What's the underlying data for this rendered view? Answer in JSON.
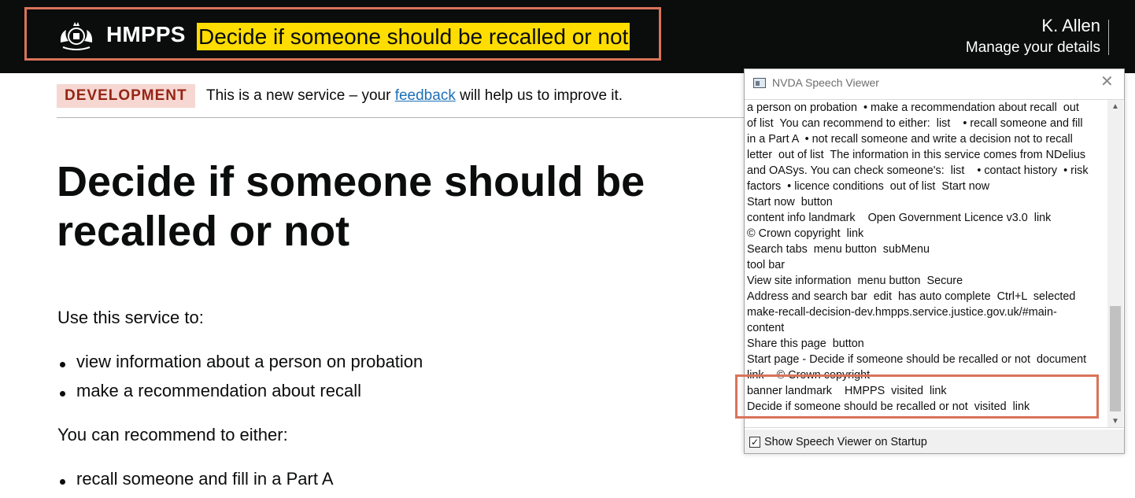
{
  "header": {
    "brand": "HMPPS",
    "service_name": "Decide if someone should be recalled or not",
    "user_name": "K. Allen",
    "manage_link": "Manage your details"
  },
  "phase_banner": {
    "tag": "DEVELOPMENT",
    "text_before": "This is a new service – your ",
    "link": "feedback",
    "text_after": " will help us to improve it."
  },
  "main": {
    "title": "Decide if someone should be recalled or not",
    "intro": "Use this service to:",
    "uses": [
      "view information about a person on probation",
      "make a recommendation about recall"
    ],
    "recommend_intro": "You can recommend to either:",
    "recommend": [
      "recall someone and fill in a Part A"
    ]
  },
  "nvda": {
    "title": "NVDA Speech Viewer",
    "lines": [
      "a person on probation  • make a recommendation about recall  out",
      "of list  You can recommend to either:  list    • recall someone and fill",
      "in a Part A  • not recall someone and write a decision not to recall",
      "letter  out of list  The information in this service comes from NDelius",
      "and OASys. You can check someone's:  list    • contact history  • risk",
      "factors  • licence conditions  out of list  Start now",
      "Start now  button",
      "content info landmark    Open Government Licence v3.0  link",
      "© Crown copyright  link",
      "Search tabs  menu button  subMenu",
      "tool bar",
      "View site information  menu button  Secure",
      "Address and search bar  edit  has auto complete  Ctrl+L  selected",
      "make-recall-decision-dev.hmpps.service.justice.gov.uk/#main-",
      "content",
      "Share this page  button",
      "Start page - Decide if someone should be recalled or not  document",
      "link    © Crown copyright",
      "banner landmark    HMPPS  visited  link",
      "Decide if someone should be recalled or not  visited  link"
    ],
    "show_on_startup_label": "Show Speech Viewer on Startup",
    "show_on_startup_checked": true
  },
  "colors": {
    "header_bg": "#0b0c0c",
    "service_highlight": "#ffdd00",
    "annotation_border": "#d9735a",
    "phase_tag_bg": "#f6d7d2",
    "phase_tag_text": "#942514",
    "link": "#1d70b8"
  }
}
